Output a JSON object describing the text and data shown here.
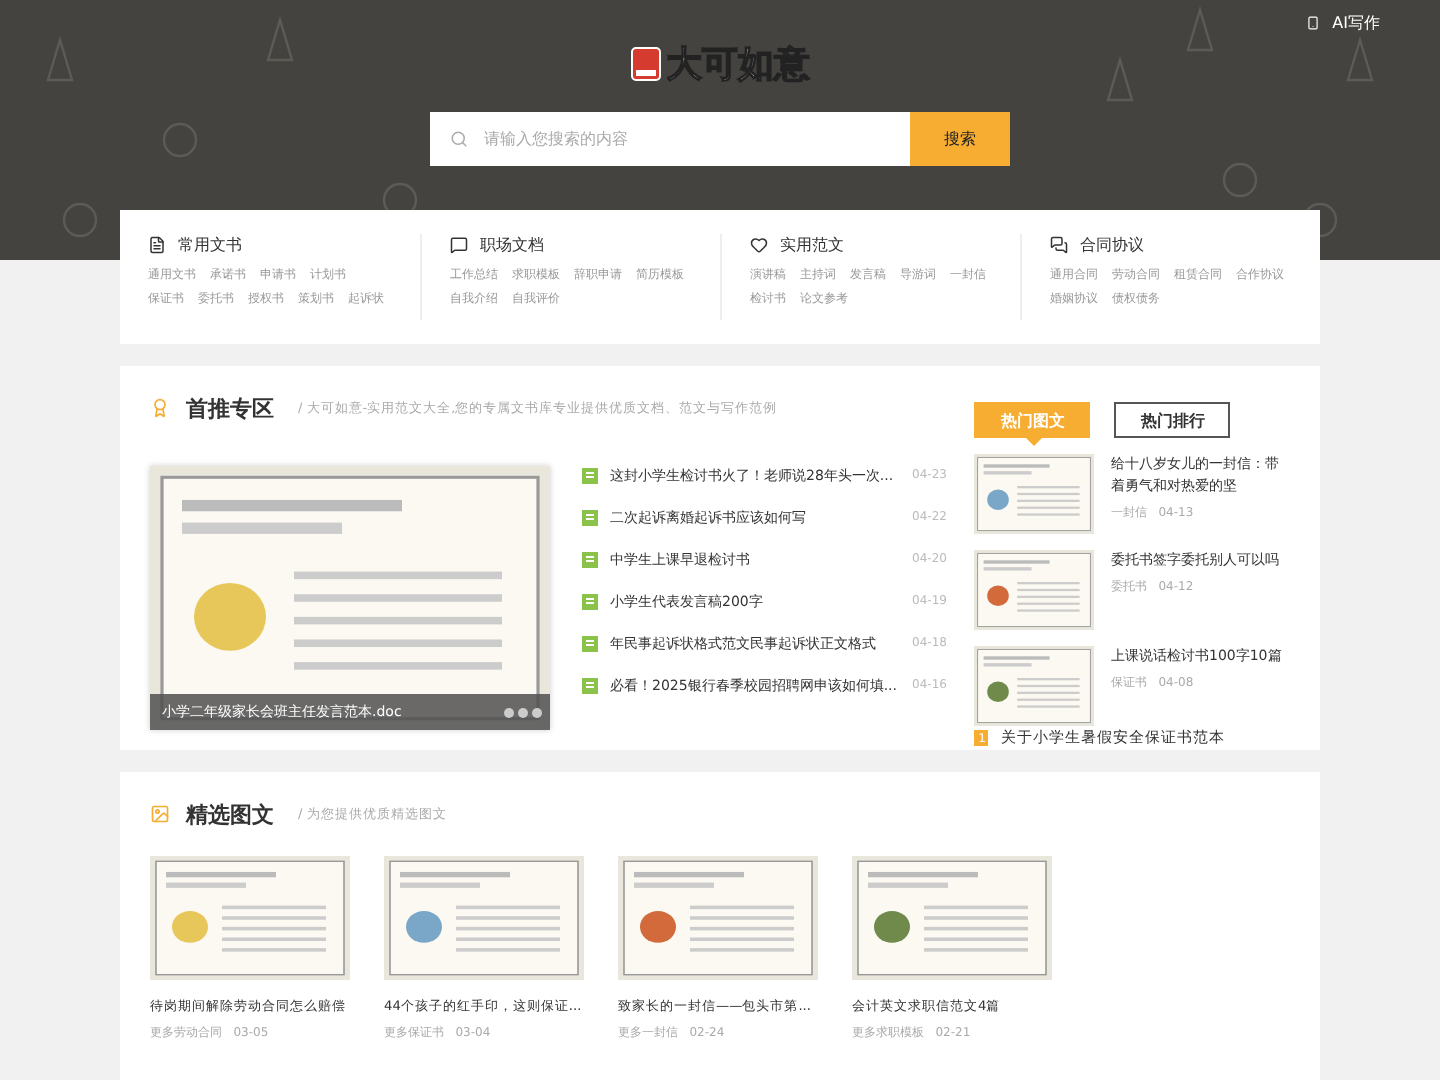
{
  "header": {
    "logo_text": "大可如意",
    "top_link": "AI写作",
    "search_placeholder": "请输入您搜索的内容",
    "search_button": "搜索"
  },
  "categories": [
    {
      "kind": "doc",
      "title": "常用文书",
      "links": [
        "通用文书",
        "承诺书",
        "申请书",
        "计划书",
        "保证书",
        "委托书",
        "授权书",
        "策划书",
        "起诉状"
      ]
    },
    {
      "kind": "chat",
      "title": "职场文档",
      "links": [
        "工作总结",
        "求职模板",
        "辞职申请",
        "简历模板",
        "自我介绍",
        "自我评价"
      ]
    },
    {
      "kind": "heart",
      "title": "实用范文",
      "links": [
        "演讲稿",
        "主持词",
        "发言稿",
        "导游词",
        "一封信",
        "检讨书",
        "论文参考"
      ]
    },
    {
      "kind": "talk",
      "title": "合同协议",
      "links": [
        "通用合同",
        "劳动合同",
        "租赁合同",
        "合作协议",
        "婚姻协议",
        "债权债务"
      ]
    }
  ],
  "featured": {
    "title": "首推专区",
    "subtitle": "/ 大可如意-实用范文大全,您的专属文书库专业提供优质文档、范文与写作范例",
    "slide_caption": "小学二年级家长会班主任发言范本.doc",
    "articles": [
      {
        "title": "这封小学生检讨书火了！老师说28年头一次...",
        "date": "04-23"
      },
      {
        "title": "二次起诉离婚起诉书应该如何写",
        "date": "04-22"
      },
      {
        "title": "中学生上课早退检讨书",
        "date": "04-20"
      },
      {
        "title": "小学生代表发言稿200字",
        "date": "04-19"
      },
      {
        "title": "年民事起诉状格式范文民事起诉状正文格式",
        "date": "04-18"
      },
      {
        "title": "必看！2025银行春季校园招聘网申该如何填...",
        "date": "04-16"
      }
    ],
    "tabs": [
      {
        "label": "热门图文",
        "selected": true
      },
      {
        "label": "热门排行",
        "selected": false
      }
    ],
    "hot": [
      {
        "title": "给十八岁女儿的一封信：带着勇气和对热爱的坚",
        "category": "一封信",
        "date": "04-13"
      },
      {
        "title": "委托书签字委托别人可以吗",
        "category": "委托书",
        "date": "04-12"
      },
      {
        "title": "上课说话检讨书100字10篇",
        "category": "保证书",
        "date": "04-08"
      }
    ],
    "ranked": {
      "number": "1",
      "title": "关于小学生暑假安全保证书范本"
    }
  },
  "picks": {
    "title": "精选图文",
    "subtitle": "/ 为您提供优质精选图文",
    "cards": [
      {
        "title": "待岗期间解除劳动合同怎么赔偿",
        "category": "更多劳动合同",
        "date": "03-05"
      },
      {
        "title": "44个孩子的红手印，这则保证...",
        "category": "更多保证书",
        "date": "03-04"
      },
      {
        "title": "致家长的一封信——包头市第...",
        "category": "更多一封信",
        "date": "02-24"
      },
      {
        "title": "会计英文求职信范文4篇",
        "category": "更多求职模板",
        "date": "02-21"
      }
    ]
  }
}
